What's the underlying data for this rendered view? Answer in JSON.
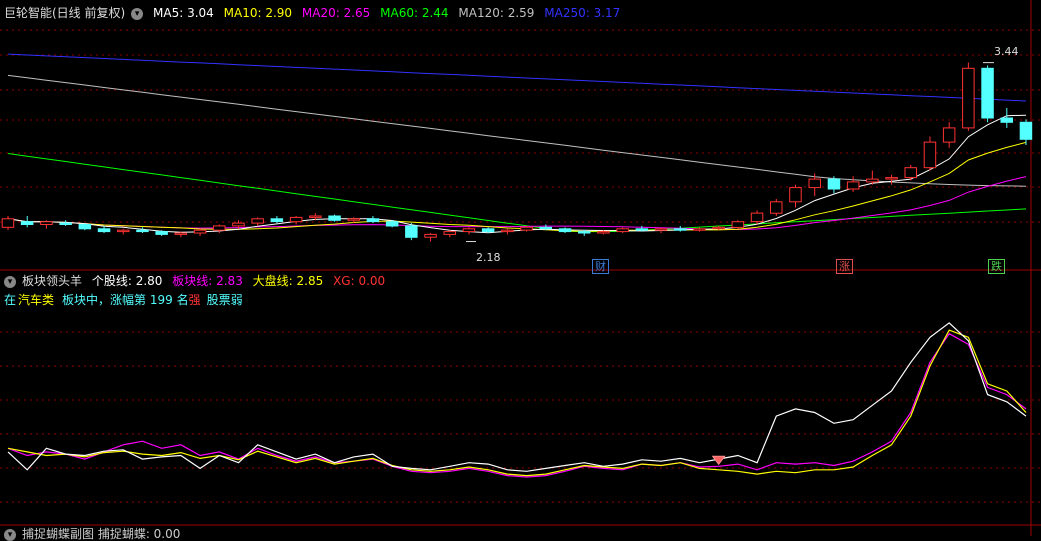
{
  "main_header": {
    "stock_title": "巨轮智能(日线 前复权)",
    "ma5": "MA5: 3.04",
    "ma10": "MA10: 2.90",
    "ma20": "MA20: 2.65",
    "ma60": "MA60: 2.44",
    "ma120": "MA120: 2.59",
    "ma250": "MA250: 3.17"
  },
  "annotations": {
    "high_label": "3.44",
    "low_label": "2.18"
  },
  "event_tags": [
    {
      "text": "财",
      "color": "#3c7bd6"
    },
    {
      "text": "涨",
      "color": "#e05050"
    },
    {
      "text": "跌",
      "color": "#50d050"
    }
  ],
  "sub_header": {
    "indicator_name": "板块领头羊",
    "stock_line": "个股线: 2.80",
    "sector_line": "板块线: 2.83",
    "market_line": "大盘线: 2.85",
    "xg": "XG: 0.00"
  },
  "sub_info": {
    "prefix": "在",
    "sector": "汽车类",
    "middle": "板块中，涨幅第 199 名",
    "strength": "强",
    "suffix": "股票弱"
  },
  "bottom_header": {
    "text": "捕捉蝴蝶副图  捕捉蝴蝶: 0.00"
  },
  "colors": {
    "up": "#ff3232",
    "down": "#54ffff",
    "ma5": "#ffffff",
    "ma10": "#ffff00",
    "ma20": "#ff00ff",
    "ma60": "#00ff00",
    "ma120": "#c0c0c0",
    "ma250": "#3232ff",
    "stock_line": "#ffffff",
    "sector_line": "#ff00ff",
    "market_line": "#ffff00",
    "xg": "#ff3232",
    "grid": "#8b0000"
  },
  "chart_data": [
    {
      "type": "candlestick",
      "title": "巨轮智能(日线 前复权)",
      "ylim": [
        2.05,
        3.55
      ],
      "annotations": [
        {
          "text": "3.44",
          "value": 3.44
        },
        {
          "text": "2.18",
          "value": 2.18
        }
      ],
      "ohlc": [
        [
          2.28,
          2.36,
          2.26,
          2.34
        ],
        [
          2.32,
          2.36,
          2.28,
          2.3
        ],
        [
          2.3,
          2.33,
          2.27,
          2.32
        ],
        [
          2.31,
          2.33,
          2.29,
          2.3
        ],
        [
          2.3,
          2.31,
          2.26,
          2.27
        ],
        [
          2.27,
          2.29,
          2.24,
          2.25
        ],
        [
          2.25,
          2.27,
          2.23,
          2.26
        ],
        [
          2.26,
          2.28,
          2.24,
          2.25
        ],
        [
          2.25,
          2.26,
          2.22,
          2.23
        ],
        [
          2.23,
          2.25,
          2.21,
          2.24
        ],
        [
          2.24,
          2.27,
          2.22,
          2.26
        ],
        [
          2.26,
          2.3,
          2.24,
          2.29
        ],
        [
          2.29,
          2.33,
          2.27,
          2.31
        ],
        [
          2.31,
          2.35,
          2.29,
          2.34
        ],
        [
          2.34,
          2.36,
          2.31,
          2.32
        ],
        [
          2.32,
          2.36,
          2.3,
          2.35
        ],
        [
          2.35,
          2.38,
          2.33,
          2.36
        ],
        [
          2.36,
          2.37,
          2.32,
          2.33
        ],
        [
          2.33,
          2.35,
          2.31,
          2.34
        ],
        [
          2.34,
          2.36,
          2.31,
          2.32
        ],
        [
          2.32,
          2.33,
          2.28,
          2.29
        ],
        [
          2.29,
          2.31,
          2.19,
          2.21
        ],
        [
          2.21,
          2.24,
          2.18,
          2.23
        ],
        [
          2.23,
          2.26,
          2.21,
          2.25
        ],
        [
          2.25,
          2.28,
          2.23,
          2.27
        ],
        [
          2.27,
          2.28,
          2.24,
          2.25
        ],
        [
          2.25,
          2.27,
          2.23,
          2.26
        ],
        [
          2.26,
          2.29,
          2.25,
          2.28
        ],
        [
          2.28,
          2.3,
          2.26,
          2.27
        ],
        [
          2.27,
          2.28,
          2.24,
          2.25
        ],
        [
          2.25,
          2.26,
          2.22,
          2.24
        ],
        [
          2.24,
          2.26,
          2.23,
          2.25
        ],
        [
          2.25,
          2.28,
          2.24,
          2.27
        ],
        [
          2.27,
          2.29,
          2.25,
          2.26
        ],
        [
          2.26,
          2.28,
          2.24,
          2.27
        ],
        [
          2.27,
          2.29,
          2.25,
          2.26
        ],
        [
          2.26,
          2.28,
          2.25,
          2.27
        ],
        [
          2.27,
          2.29,
          2.26,
          2.28
        ],
        [
          2.28,
          2.33,
          2.27,
          2.32
        ],
        [
          2.32,
          2.4,
          2.3,
          2.38
        ],
        [
          2.38,
          2.48,
          2.36,
          2.46
        ],
        [
          2.46,
          2.58,
          2.42,
          2.56
        ],
        [
          2.56,
          2.66,
          2.5,
          2.62
        ],
        [
          2.62,
          2.64,
          2.52,
          2.55
        ],
        [
          2.55,
          2.64,
          2.53,
          2.6
        ],
        [
          2.6,
          2.68,
          2.58,
          2.62
        ],
        [
          2.62,
          2.65,
          2.58,
          2.63
        ],
        [
          2.63,
          2.72,
          2.61,
          2.7
        ],
        [
          2.7,
          2.92,
          2.68,
          2.88
        ],
        [
          2.88,
          3.02,
          2.84,
          2.98
        ],
        [
          2.98,
          3.44,
          2.96,
          3.4
        ],
        [
          3.4,
          3.42,
          3.02,
          3.05
        ],
        [
          3.05,
          3.12,
          2.98,
          3.02
        ],
        [
          3.02,
          3.04,
          2.86,
          2.9
        ]
      ]
    },
    {
      "type": "line",
      "title": "板块领头羊",
      "ylim": [
        0.5,
        3.5
      ],
      "series": [
        {
          "name": "个股线",
          "values": [
            1.45,
            1.2,
            1.5,
            1.42,
            1.4,
            1.46,
            1.48,
            1.35,
            1.38,
            1.4,
            1.22,
            1.4,
            1.3,
            1.55,
            1.45,
            1.35,
            1.42,
            1.3,
            1.38,
            1.42,
            1.25,
            1.22,
            1.2,
            1.25,
            1.3,
            1.28,
            1.2,
            1.18,
            1.22,
            1.26,
            1.3,
            1.25,
            1.28,
            1.34,
            1.32,
            1.36,
            1.3,
            1.35,
            1.4,
            1.3,
            1.95,
            2.05,
            2.0,
            1.85,
            1.9,
            2.1,
            2.3,
            2.7,
            3.05,
            3.25,
            3.0,
            2.25,
            2.15,
            1.95
          ]
        },
        {
          "name": "板块线",
          "values": [
            1.5,
            1.4,
            1.45,
            1.42,
            1.35,
            1.45,
            1.55,
            1.6,
            1.5,
            1.55,
            1.4,
            1.45,
            1.35,
            1.5,
            1.4,
            1.32,
            1.38,
            1.3,
            1.32,
            1.35,
            1.25,
            1.18,
            1.16,
            1.18,
            1.22,
            1.18,
            1.12,
            1.1,
            1.12,
            1.18,
            1.25,
            1.22,
            1.2,
            1.28,
            1.26,
            1.3,
            1.24,
            1.25,
            1.28,
            1.2,
            1.3,
            1.28,
            1.3,
            1.26,
            1.32,
            1.45,
            1.6,
            2.0,
            2.7,
            3.1,
            2.95,
            2.35,
            2.25,
            2.05
          ]
        },
        {
          "name": "大盘线",
          "values": [
            1.5,
            1.45,
            1.4,
            1.42,
            1.38,
            1.44,
            1.46,
            1.42,
            1.4,
            1.44,
            1.36,
            1.4,
            1.34,
            1.46,
            1.38,
            1.3,
            1.36,
            1.28,
            1.32,
            1.36,
            1.26,
            1.2,
            1.18,
            1.2,
            1.24,
            1.2,
            1.14,
            1.12,
            1.14,
            1.2,
            1.26,
            1.24,
            1.22,
            1.28,
            1.26,
            1.3,
            1.22,
            1.2,
            1.18,
            1.14,
            1.18,
            1.16,
            1.2,
            1.2,
            1.24,
            1.4,
            1.55,
            1.95,
            2.65,
            3.15,
            3.05,
            2.4,
            2.3,
            2.0
          ]
        }
      ],
      "markers": [
        {
          "name": "XG",
          "index": 37
        }
      ]
    }
  ]
}
